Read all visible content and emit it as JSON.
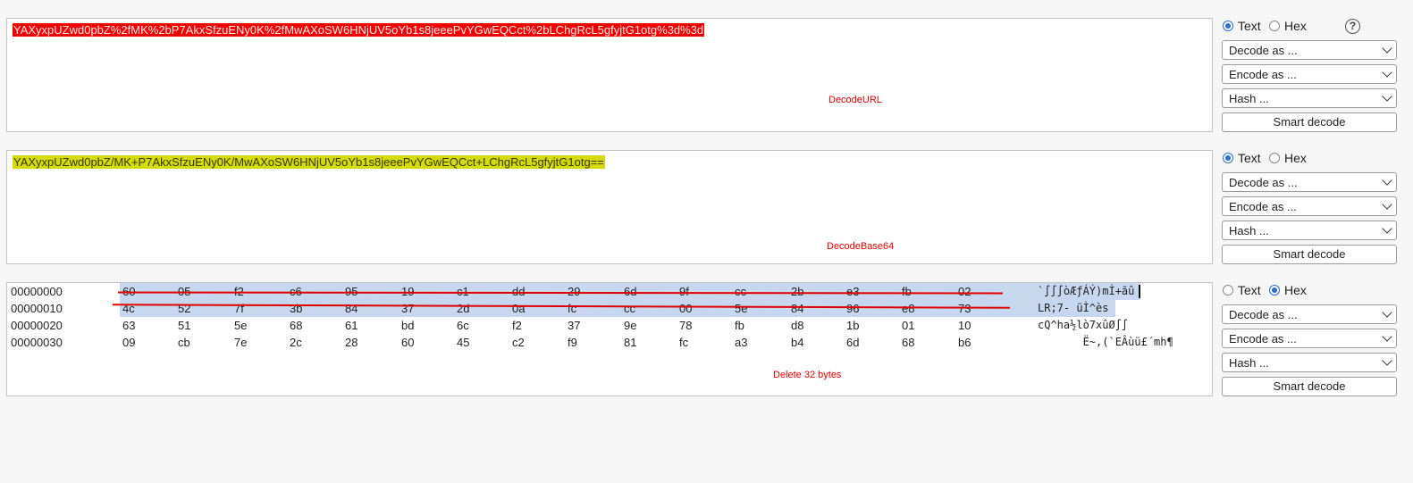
{
  "panels": [
    {
      "mode": "text",
      "text": "YAXyxpUZwd0pbZ%2fMK%2bP7AkxSfzuENy0K%2fMwAXoSW6HNjUV5oYb1s8jeeePvYGwEQCct%2bLChgRcL5gfyjtG1otg%3d%3d",
      "highlight_color": "#ee0000",
      "annotation": "DecodeURL",
      "controls": {
        "text_label": "Text",
        "hex_label": "Hex",
        "selected": "text",
        "decode": "Decode as ...",
        "encode": "Encode as ...",
        "hash": "Hash ...",
        "smart": "Smart decode",
        "help": "?"
      }
    },
    {
      "mode": "text",
      "text": "YAXyxpUZwd0pbZ/MK+P7AkxSfzuENy0K/MwAXoSW6HNjUV5oYb1s8jeeePvYGwEQCct+LChgRcL5gfyjtG1otg==",
      "highlight_color": "#d5db0a",
      "annotation": "DecodeBase64",
      "controls": {
        "text_label": "Text",
        "hex_label": "Hex",
        "selected": "text",
        "decode": "Decode as ...",
        "encode": "Encode as ...",
        "hash": "Hash ...",
        "smart": "Smart decode"
      }
    },
    {
      "mode": "hex",
      "annotation": "Delete 32 bytes",
      "hex_rows": [
        {
          "offset": "00000000",
          "bytes": [
            "60",
            "05",
            "f2",
            "c6",
            "95",
            "19",
            "c1",
            "dd",
            "29",
            "6d",
            "9f",
            "cc",
            "2b",
            "e3",
            "fb",
            "02"
          ],
          "ascii": "`∫∫∫òÆƒÁÝ)mÌ+ãû",
          "selected": true,
          "struck": true
        },
        {
          "offset": "00000010",
          "bytes": [
            "4c",
            "52",
            "7f",
            "3b",
            "84",
            "37",
            "2d",
            "0a",
            "fc",
            "cc",
            "00",
            "5e",
            "84",
            "96",
            "e8",
            "73"
          ],
          "ascii": "LR;7- üÌ^ès",
          "selected": true,
          "struck": true
        },
        {
          "offset": "00000020",
          "bytes": [
            "63",
            "51",
            "5e",
            "68",
            "61",
            "bd",
            "6c",
            "f2",
            "37",
            "9e",
            "78",
            "fb",
            "d8",
            "1b",
            "01",
            "10"
          ],
          "ascii": "cQ^ha½lò7xûØ∫∫",
          "selected": false,
          "struck": false
        },
        {
          "offset": "00000030",
          "bytes": [
            "09",
            "cb",
            "7e",
            "2c",
            "28",
            "60",
            "45",
            "c2",
            "f9",
            "81",
            "fc",
            "a3",
            "b4",
            "6d",
            "68",
            "b6"
          ],
          "ascii": "       Ë~,(`EÂùü£´mh¶",
          "selected": false,
          "struck": false
        }
      ],
      "controls": {
        "text_label": "Text",
        "hex_label": "Hex",
        "selected": "hex",
        "decode": "Decode as ...",
        "encode": "Encode as ...",
        "hash": "Hash ...",
        "smart": "Smart decode"
      }
    }
  ]
}
